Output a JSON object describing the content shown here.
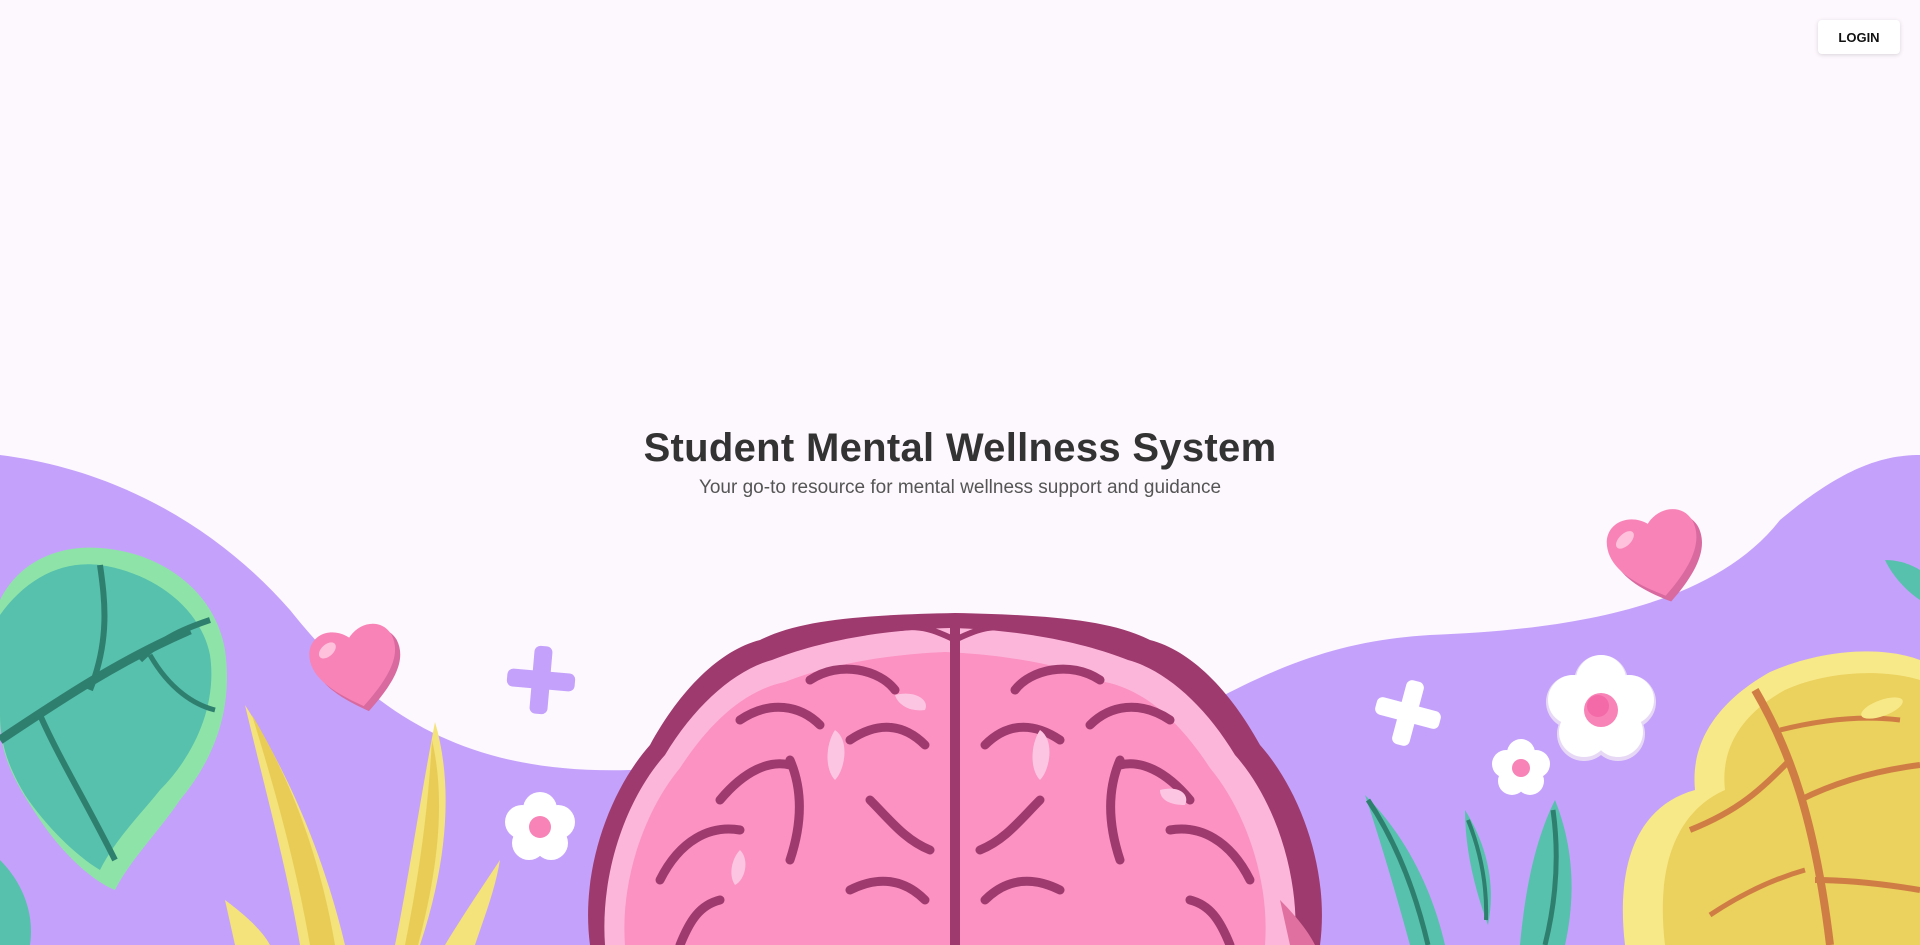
{
  "header": {
    "login_label": "LOGIN"
  },
  "hero": {
    "title": "Student Mental Wellness System",
    "subtitle": "Your go-to resource for mental wellness support and guidance"
  },
  "colors": {
    "background": "#fdf8fd",
    "wave": "#c4a1fb",
    "brain": "#fb92c2",
    "brain_dark": "#9e3a6e",
    "heart": "#f883b7",
    "leaf_green": "#5ac5ad",
    "leaf_yellow": "#f0d463"
  },
  "icons": [
    "heart-icon",
    "plus-icon",
    "flower-icon",
    "brain-illustration",
    "leaf-illustration"
  ]
}
